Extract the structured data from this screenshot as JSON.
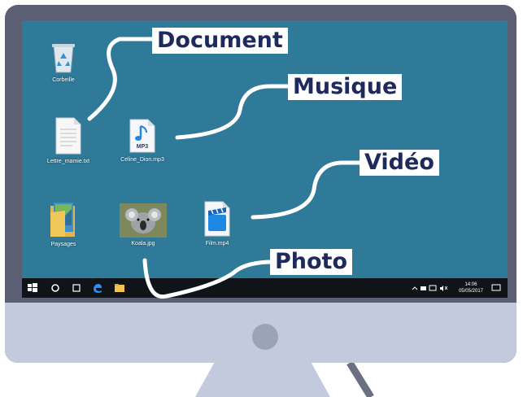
{
  "desktop": {
    "icons": [
      {
        "label": "Corbeille",
        "icon": "recycle-bin-icon"
      },
      {
        "label": "Lettre_mamie.txt",
        "icon": "text-file-icon"
      },
      {
        "label": "Celine_Dion.mp3",
        "icon": "mp3-file-icon",
        "badge": "MP3"
      },
      {
        "label": "Paysages",
        "icon": "folder-icon"
      },
      {
        "label": "Koala.jpg",
        "icon": "photo-file-icon"
      },
      {
        "label": "Film.mp4",
        "icon": "video-file-icon"
      }
    ]
  },
  "callouts": {
    "document": "Document",
    "musique": "Musique",
    "video": "Vidéo",
    "photo": "Photo"
  },
  "taskbar": {
    "time": "14:06",
    "date": "05/05/2017",
    "items": [
      "start-icon",
      "search-icon",
      "task-view-icon",
      "edge-icon",
      "file-explorer-icon"
    ]
  },
  "colors": {
    "desktop": "#2e7a98",
    "taskbar": "#101318",
    "bezel": "#5c5f73",
    "chin": "#c3cade",
    "callout_text": "#1f2a5c"
  }
}
